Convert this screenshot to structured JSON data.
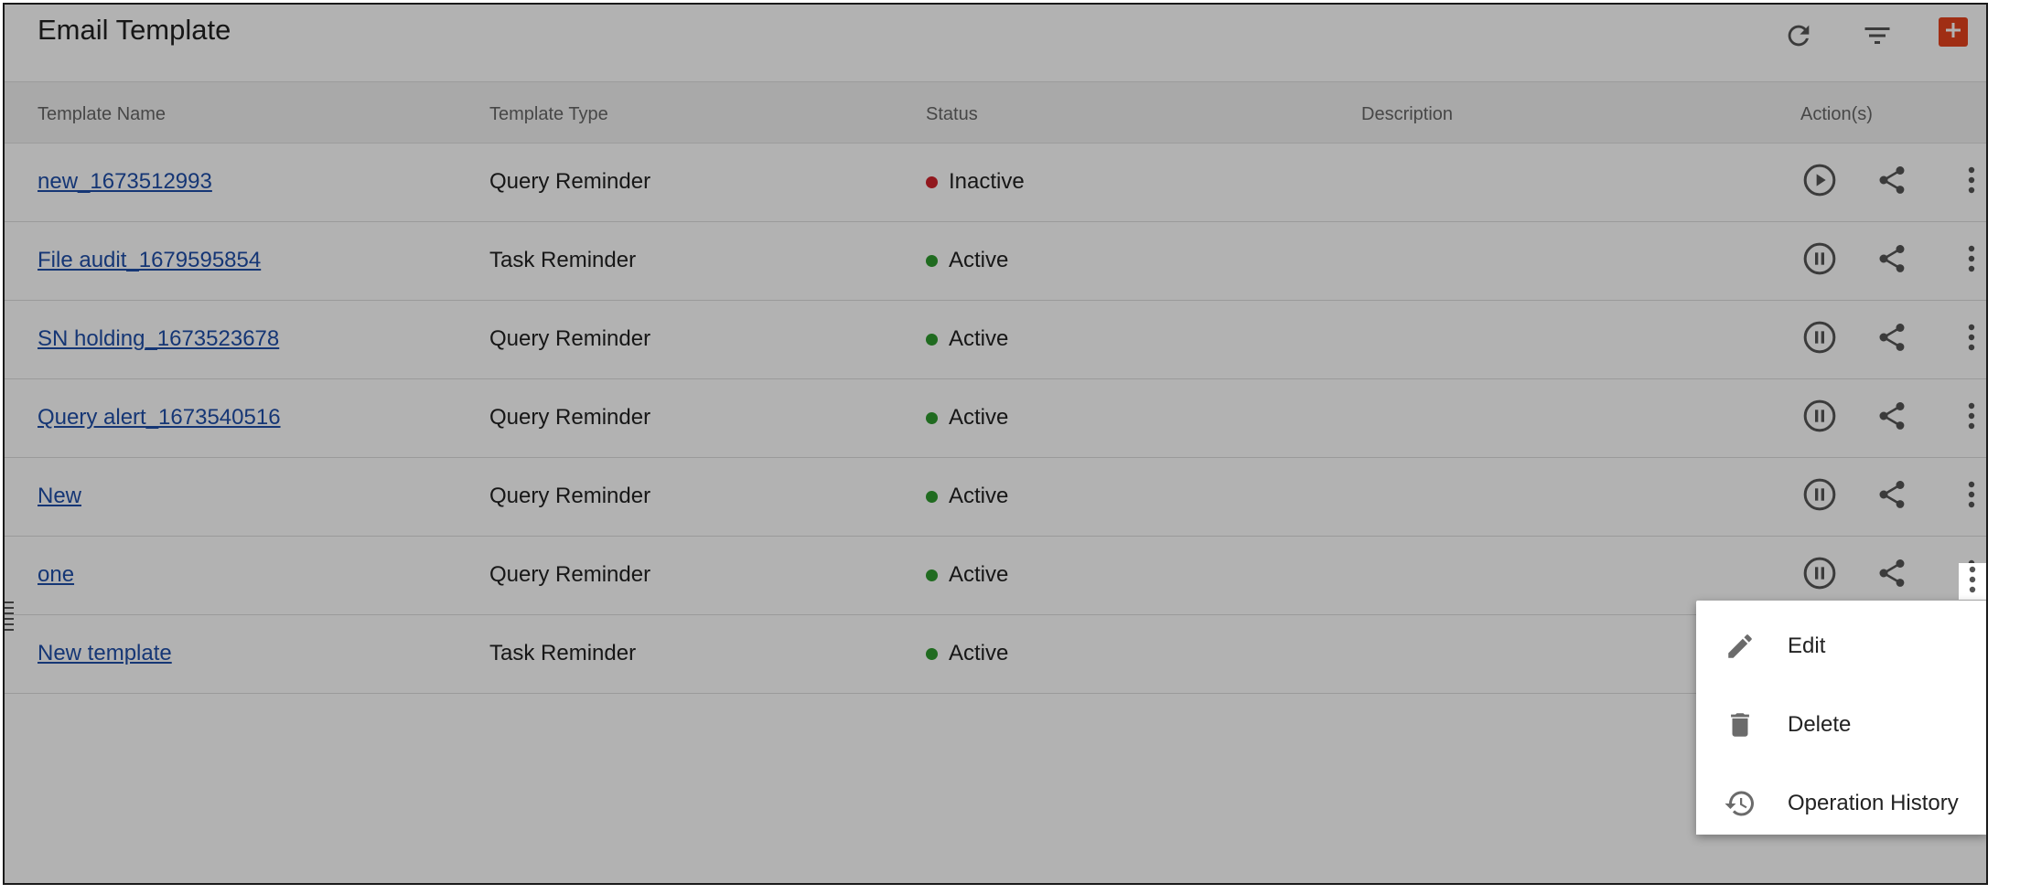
{
  "header": {
    "title": "Email Template",
    "refresh_icon": "refresh-icon",
    "filter_icon": "filter-icon",
    "add_icon": "plus-icon",
    "accent_color": "#e6431e"
  },
  "table": {
    "columns": [
      "Template Name",
      "Template Type",
      "Status",
      "Description",
      "Action(s)"
    ],
    "rows": [
      {
        "name": "new_1673512993",
        "type": "Query Reminder",
        "status": "Inactive",
        "description": "",
        "toggle_icon": "play-icon"
      },
      {
        "name": "File audit_1679595854",
        "type": "Task Reminder",
        "status": "Active",
        "description": "",
        "toggle_icon": "pause-icon"
      },
      {
        "name": "SN holding_1673523678",
        "type": "Query Reminder",
        "status": "Active",
        "description": "",
        "toggle_icon": "pause-icon"
      },
      {
        "name": "Query alert_1673540516",
        "type": "Query Reminder",
        "status": "Active",
        "description": "",
        "toggle_icon": "pause-icon"
      },
      {
        "name": "New",
        "type": "Query Reminder",
        "status": "Active",
        "description": "",
        "toggle_icon": "pause-icon"
      },
      {
        "name": "one",
        "type": "Query Reminder",
        "status": "Active",
        "description": "",
        "toggle_icon": "pause-icon"
      },
      {
        "name": "New template",
        "type": "Task Reminder",
        "status": "Active",
        "description": "",
        "toggle_icon": "pause-icon"
      }
    ],
    "status_colors": {
      "Active": "#2e9a2e",
      "Inactive": "#d0232b"
    }
  },
  "context_menu": {
    "items": [
      {
        "label": "Edit",
        "icon": "pencil-icon"
      },
      {
        "label": "Delete",
        "icon": "trash-icon"
      },
      {
        "label": "Operation History",
        "icon": "history-icon"
      }
    ]
  }
}
